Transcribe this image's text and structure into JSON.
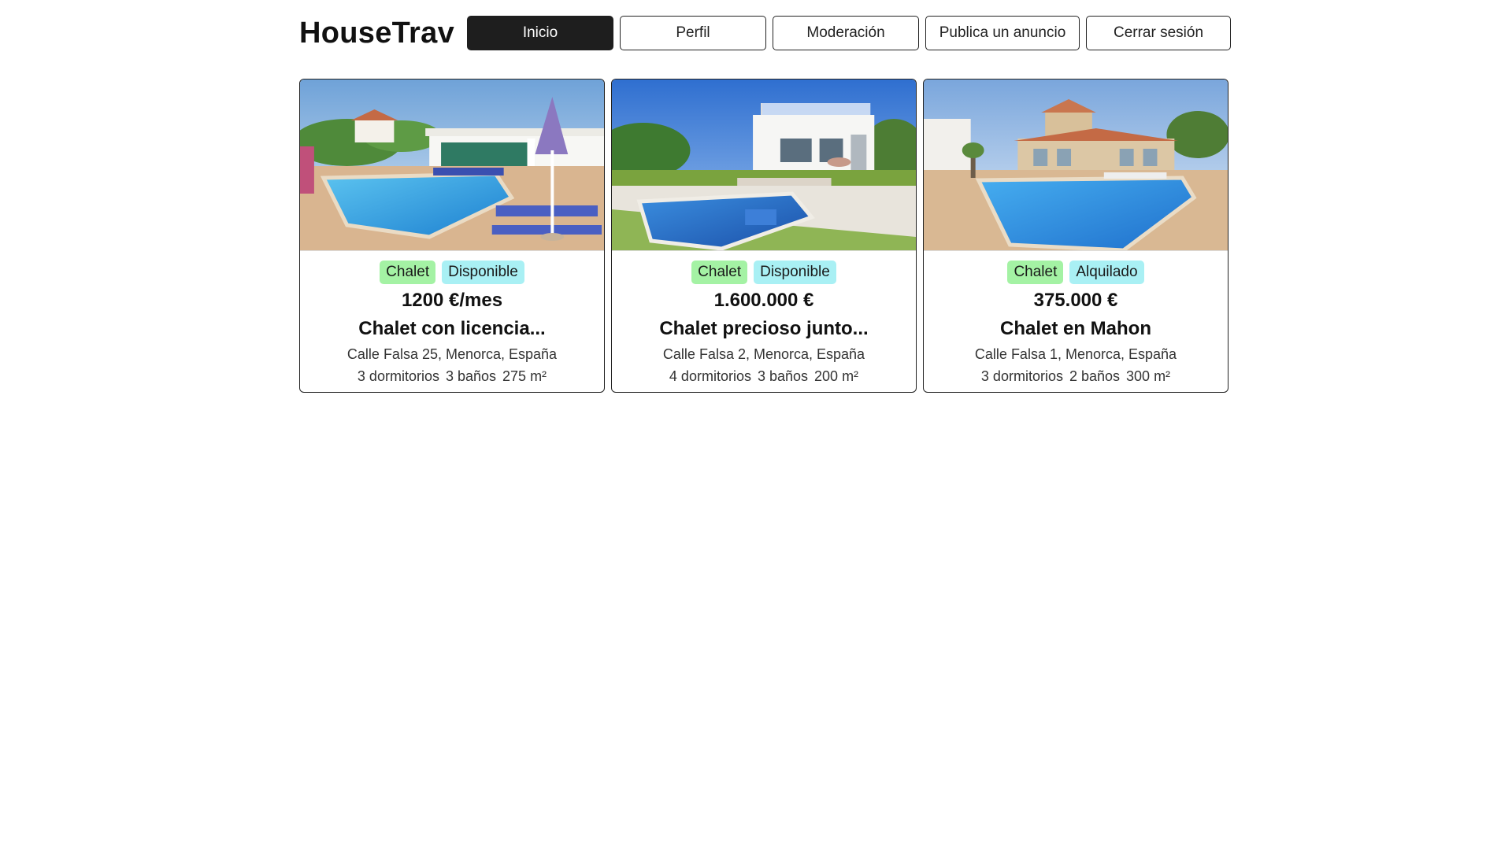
{
  "header": {
    "brand": "HouseTrav",
    "nav": [
      {
        "label": "Inicio",
        "active": true
      },
      {
        "label": "Perfil",
        "active": false
      },
      {
        "label": "Moderación",
        "active": false
      },
      {
        "label": "Publica un anuncio",
        "active": false
      },
      {
        "label": "Cerrar sesión",
        "active": false
      }
    ]
  },
  "listings": [
    {
      "type": "Chalet",
      "status": "Disponible",
      "price": "1200 €/mes",
      "title": "Chalet con licencia...",
      "address": "Calle Falsa 25, Menorca, España",
      "bedrooms": "3 dormitorios",
      "bathrooms": "3 baños",
      "area": "275 m²"
    },
    {
      "type": "Chalet",
      "status": "Disponible",
      "price": "1.600.000 €",
      "title": "Chalet precioso junto...",
      "address": "Calle Falsa 2, Menorca, España",
      "bedrooms": "4 dormitorios",
      "bathrooms": "3 baños",
      "area": "200 m²"
    },
    {
      "type": "Chalet",
      "status": "Alquilado",
      "price": "375.000 €",
      "title": "Chalet en Mahon",
      "address": "Calle Falsa 1, Menorca, España",
      "bedrooms": "3 dormitorios",
      "bathrooms": "2 baños",
      "area": "300 m²"
    }
  ],
  "colors": {
    "nav_active_bg": "#1e1e1e",
    "tag_type_bg": "#a4f2a4",
    "tag_status_bg": "#a9f0f4"
  }
}
